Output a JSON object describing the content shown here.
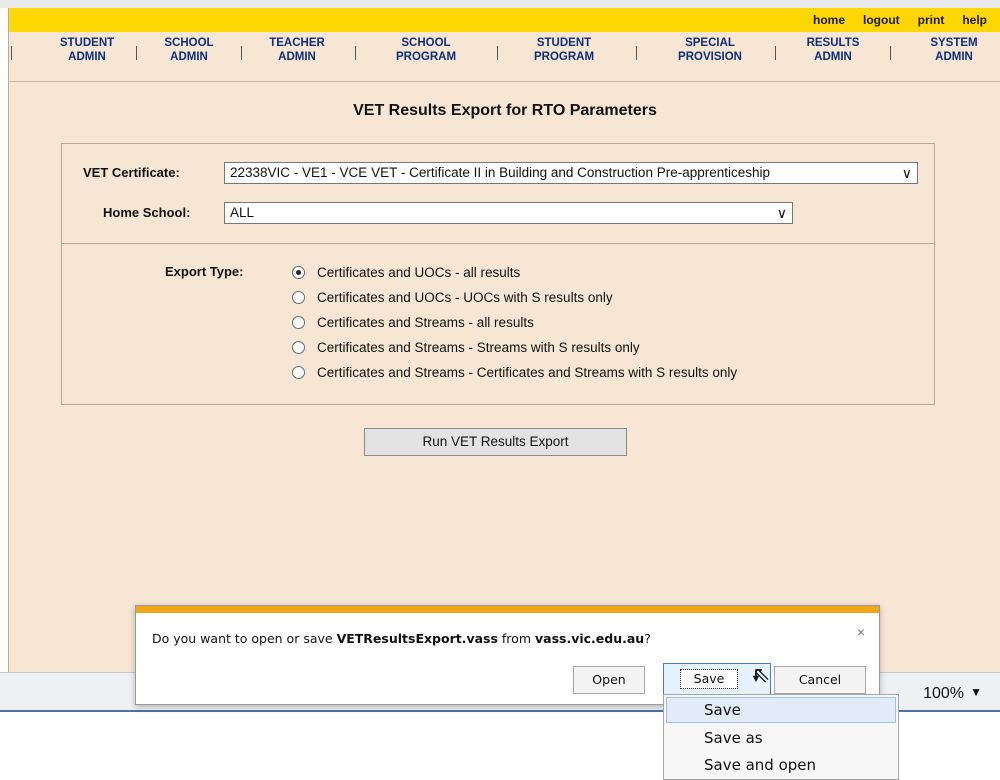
{
  "utility_links": [
    "home",
    "logout",
    "print",
    "help"
  ],
  "nav": [
    {
      "line1": "STUDENT",
      "line2": "ADMIN"
    },
    {
      "line1": "SCHOOL",
      "line2": "ADMIN"
    },
    {
      "line1": "TEACHER",
      "line2": "ADMIN"
    },
    {
      "line1": "SCHOOL",
      "line2": "PROGRAM"
    },
    {
      "line1": "STUDENT",
      "line2": "PROGRAM"
    },
    {
      "line1": "SPECIAL",
      "line2": "PROVISION"
    },
    {
      "line1": "RESULTS",
      "line2": "ADMIN"
    },
    {
      "line1": "SYSTEM",
      "line2": "ADMIN"
    }
  ],
  "page_title": "VET Results Export for RTO Parameters",
  "form": {
    "vet_certificate_label": "VET Certificate:",
    "vet_certificate_value": "22338VIC - VE1 - VCE VET - Certificate II in Building and Construction Pre-apprenticeship",
    "home_school_label": "Home School:",
    "home_school_value": "ALL",
    "export_type_label": "Export Type:",
    "export_options": [
      "Certificates and UOCs - all results",
      "Certificates and UOCs - UOCs with S results only",
      "Certificates and Streams - all results",
      "Certificates and Streams - Streams with S results only",
      "Certificates and Streams - Certificates and Streams with S results only"
    ],
    "selected_export_option": 0,
    "run_button": "Run VET Results Export"
  },
  "dialog": {
    "prefix": "Do you want to open or save ",
    "filename": "VETResultsExport.vass",
    "middle": " from ",
    "domain": "vass.vic.edu.au",
    "suffix": "?",
    "close": "×",
    "open_button": "Open",
    "save_button": "Save",
    "cancel_button": "Cancel"
  },
  "save_menu": [
    "Save",
    "Save as",
    "Save and open"
  ],
  "status_bar": {
    "zoom": "100%"
  },
  "colors": {
    "page_bg": "#f7e6d4",
    "top_bar": "#ffd700",
    "nav_text": "#0e2e7a",
    "dialog_accent": "#f0a818"
  }
}
